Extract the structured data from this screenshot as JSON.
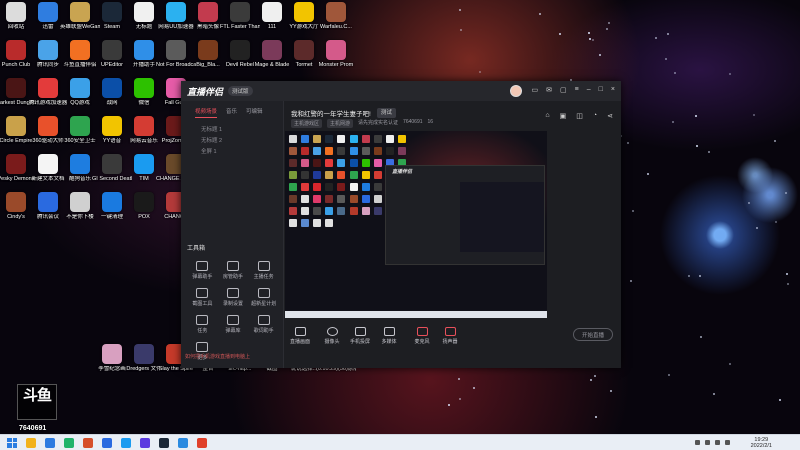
{
  "desktop": {
    "icons": [
      {
        "label": "回收站",
        "color": "#dcdcdc"
      },
      {
        "label": "迅雷",
        "color": "#2f7de0"
      },
      {
        "label": "英雄联盟WeGame",
        "color": "#c9a451"
      },
      {
        "label": "Steam",
        "color": "#1b2838"
      },
      {
        "label": "无标题",
        "color": "#f0f0f0"
      },
      {
        "label": "网易UU加速器",
        "color": "#2bb1f0"
      },
      {
        "label": "黑暗头像",
        "color": "#c23b4e"
      },
      {
        "label": "FTL Faster Than Light",
        "color": "#3b3b3b"
      },
      {
        "label": "111",
        "color": "#efefef"
      },
      {
        "label": "YY游戏大厅",
        "color": "#f2c400"
      },
      {
        "label": "Warfaleu.C...",
        "color": "#a0573a"
      },
      {
        "label": "Punch Club",
        "color": "#b92b2b"
      },
      {
        "label": "腾讯同步",
        "color": "#4aa3e8"
      },
      {
        "label": "斗鱼直播伴侣",
        "color": "#f27022"
      },
      {
        "label": "UPEditor",
        "color": "#3a3a3a"
      },
      {
        "label": "开播助手",
        "color": "#2f8fe8"
      },
      {
        "label": "Not For Broadcast",
        "color": "#5b5b5b"
      },
      {
        "label": "Big_Bla...",
        "color": "#7a3b1c"
      },
      {
        "label": "Devil Rebel",
        "color": "#222222"
      },
      {
        "label": "Mage & Blade",
        "color": "#7b3a5a"
      },
      {
        "label": "Tormet",
        "color": "#5c2a2a"
      },
      {
        "label": "Monster Prom",
        "color": "#d45a8a"
      },
      {
        "label": "Darkest Dungeon",
        "color": "#4a1515"
      },
      {
        "label": "腾讯游戏加速器",
        "color": "#e33b3b"
      },
      {
        "label": "QQ游戏",
        "color": "#3ba0e8"
      },
      {
        "label": "战网",
        "color": "#0b4fa8"
      },
      {
        "label": "微信",
        "color": "#2dc100"
      },
      {
        "label": "Fall Gu...",
        "color": "#e65ca8"
      },
      {
        "label": "联想电脑管家",
        "color": "#3a6de0"
      },
      {
        "label": "360安全卫士",
        "color": "#2ea44f"
      },
      {
        "label": "Cordial Expedition",
        "color": "#7a9a3a"
      },
      {
        "label": "EliteMedia",
        "color": "#333333"
      },
      {
        "label": "PS4",
        "color": "#1f3a9a"
      },
      {
        "label": "Circle Empire",
        "color": "#c9a14a"
      },
      {
        "label": "360驱动大师",
        "color": "#e8512b"
      },
      {
        "label": "360安全卫士",
        "color": "#2ea44f"
      },
      {
        "label": "YY语音",
        "color": "#f2c400"
      },
      {
        "label": "网易云音乐",
        "color": "#d43c33"
      },
      {
        "label": "ProjZomb...",
        "color": "#6b1a1a"
      },
      {
        "label": "360浏览器",
        "color": "#3fa4e4"
      },
      {
        "label": "360安全浏览器",
        "color": "#2ea44f"
      },
      {
        "label": "网易有道词典",
        "color": "#e03a3a"
      },
      {
        "label": "有道",
        "color": "#d8262c"
      },
      {
        "label": "Fights in Tight",
        "color": "#222222"
      },
      {
        "label": "Pesky Demons",
        "color": "#7a1b1b"
      },
      {
        "label": "新建文本文档",
        "color": "#f4f4f4"
      },
      {
        "label": "酷狗音乐",
        "color": "#1e7de0"
      },
      {
        "label": "GI Second Deathwalker",
        "color": "#3a3a3a"
      },
      {
        "label": "TIM",
        "color": "#1a9bf0"
      },
      {
        "label": "CHANGE A Homeless",
        "color": "#6a4a2a"
      },
      {
        "label": "DYSMANTLE",
        "color": "#6a3a2a"
      },
      {
        "label": "温州",
        "color": "#e0e0e0"
      },
      {
        "label": "向前的一天",
        "color": "#e03a6a"
      },
      {
        "label": "Warlaste",
        "color": "#7a2a2a"
      },
      {
        "label": "Warlaste MADE",
        "color": "#5a5a5a"
      },
      {
        "label": "Cindy's",
        "color": "#9a4a2a"
      },
      {
        "label": "腾讯会议",
        "color": "#2a6ae0"
      },
      {
        "label": "不是你下楼",
        "color": "#d0d0d0"
      },
      {
        "label": "一键清理",
        "color": "#1a7ae0"
      },
      {
        "label": "POX",
        "color": "#1a1a1a"
      },
      {
        "label": "CHANGE",
        "color": "#b43a3a"
      },
      {
        "label": "收起",
        "color": "#e0e0e0"
      },
      {
        "label": "设置新版",
        "color": "#4a4a4a"
      },
      {
        "label": "下载",
        "color": "#3aa0e8"
      },
      {
        "label": "Brothers",
        "color": "#4a6a8a"
      },
      {
        "label": "Hades",
        "color": "#b43a2a"
      },
      {
        "label": "李雪纪念画",
        "color": "#d8a0c0"
      },
      {
        "label": "Dredgers 文件",
        "color": "#3a3a6a"
      },
      {
        "label": "Slay the Spire",
        "color": "#c63a2a"
      },
      {
        "label": "整合",
        "color": "#f0c040"
      },
      {
        "label": "src-http...",
        "color": "#e0e0e0"
      },
      {
        "label": "截图",
        "color": "#5a8ad0"
      },
      {
        "label": "说说选择...",
        "color": "#e0e0e0"
      },
      {
        "label": "(0.10.29)(56)原版",
        "color": "#e0e0e0"
      }
    ]
  },
  "app": {
    "brand": "直播伴侣",
    "version": "测试版",
    "tabs": [
      "视频场景",
      "音乐",
      "可编辑"
    ],
    "scenes": [
      "无标题 1",
      "无标题 2",
      "全屏 1"
    ],
    "tools_title": "工具箱",
    "tools": [
      "弹幕助手",
      "房管助手",
      "主播任务",
      "截图工具",
      "录制设置",
      "超新星计划",
      "任务",
      "弹幕库",
      "歌词助手",
      "更多"
    ],
    "bottom_notice": "如何把手机游戏直播到电脑上",
    "room_title": "我和红警的一年学生妻子吧!",
    "room_tag": "测试",
    "room_category1": "主机游戏区",
    "room_category2": "主机网游",
    "room_meta": "请先完成实名认证",
    "room_id": "7640691",
    "fans": "16",
    "bottom_buttons": [
      "直播画面",
      "摄像头",
      "手机投屏",
      "多媒体",
      "麦克风",
      "扬声器"
    ],
    "live_button": "开始直播"
  },
  "overlay": {
    "logo_text": "斗鱼",
    "room_id": "7640691"
  },
  "taskbar": {
    "time": "19:29",
    "date": "2022/2/1",
    "apps": [
      "#f2b21c",
      "#2d7be0",
      "#1fb36b",
      "#d64f2a",
      "#2a6ae0",
      "#1a9bf0",
      "#5a3ae0",
      "#1b2838",
      "#2a8ae0",
      "#e0402a"
    ]
  }
}
